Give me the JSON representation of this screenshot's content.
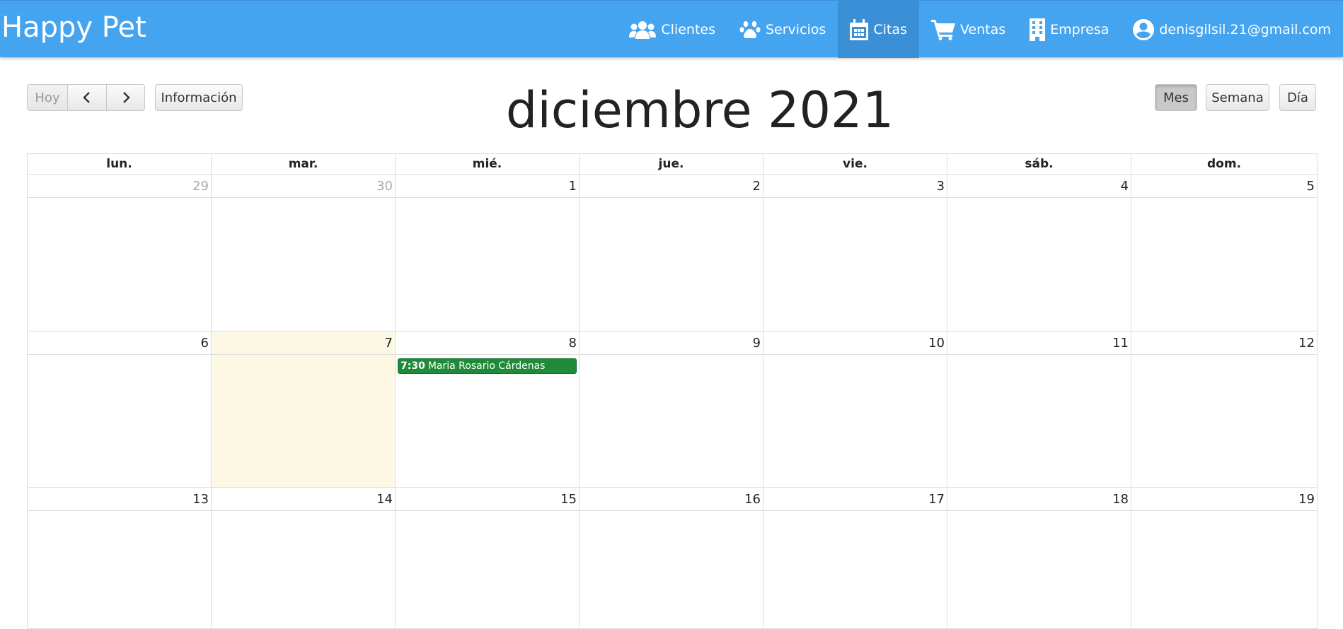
{
  "navbar": {
    "brand": "Happy Pet",
    "items": [
      {
        "label": "Clientes",
        "icon": "users-icon"
      },
      {
        "label": "Servicios",
        "icon": "paw-icon"
      },
      {
        "label": "Citas",
        "icon": "calendar-icon",
        "active": true
      },
      {
        "label": "Ventas",
        "icon": "cart-icon"
      },
      {
        "label": "Empresa",
        "icon": "building-icon"
      },
      {
        "label": "denisgilsil.21@gmail.com",
        "icon": "user-circle-icon"
      }
    ],
    "color": "#45a4f0"
  },
  "toolbar": {
    "today": "Hoy",
    "prev_icon": "chevron-left-icon",
    "next_icon": "chevron-right-icon",
    "info": "Información",
    "title": "diciembre 2021",
    "views": {
      "month": "Mes",
      "week": "Semana",
      "day": "Día"
    },
    "active_view": "Mes"
  },
  "calendar": {
    "weekdays": [
      "lun.",
      "mar.",
      "mié.",
      "jue.",
      "vie.",
      "sáb.",
      "dom."
    ],
    "weeks": [
      [
        "29",
        "30",
        "1",
        "2",
        "3",
        "4",
        "5"
      ],
      [
        "6",
        "7",
        "8",
        "9",
        "10",
        "11",
        "12"
      ],
      [
        "13",
        "14",
        "15",
        "16",
        "17",
        "18",
        "19"
      ]
    ],
    "today": "7",
    "event": {
      "time": "7:30",
      "title": "Maria Rosario Cárdenas",
      "day": "8",
      "color": "#1f8a3a"
    }
  }
}
